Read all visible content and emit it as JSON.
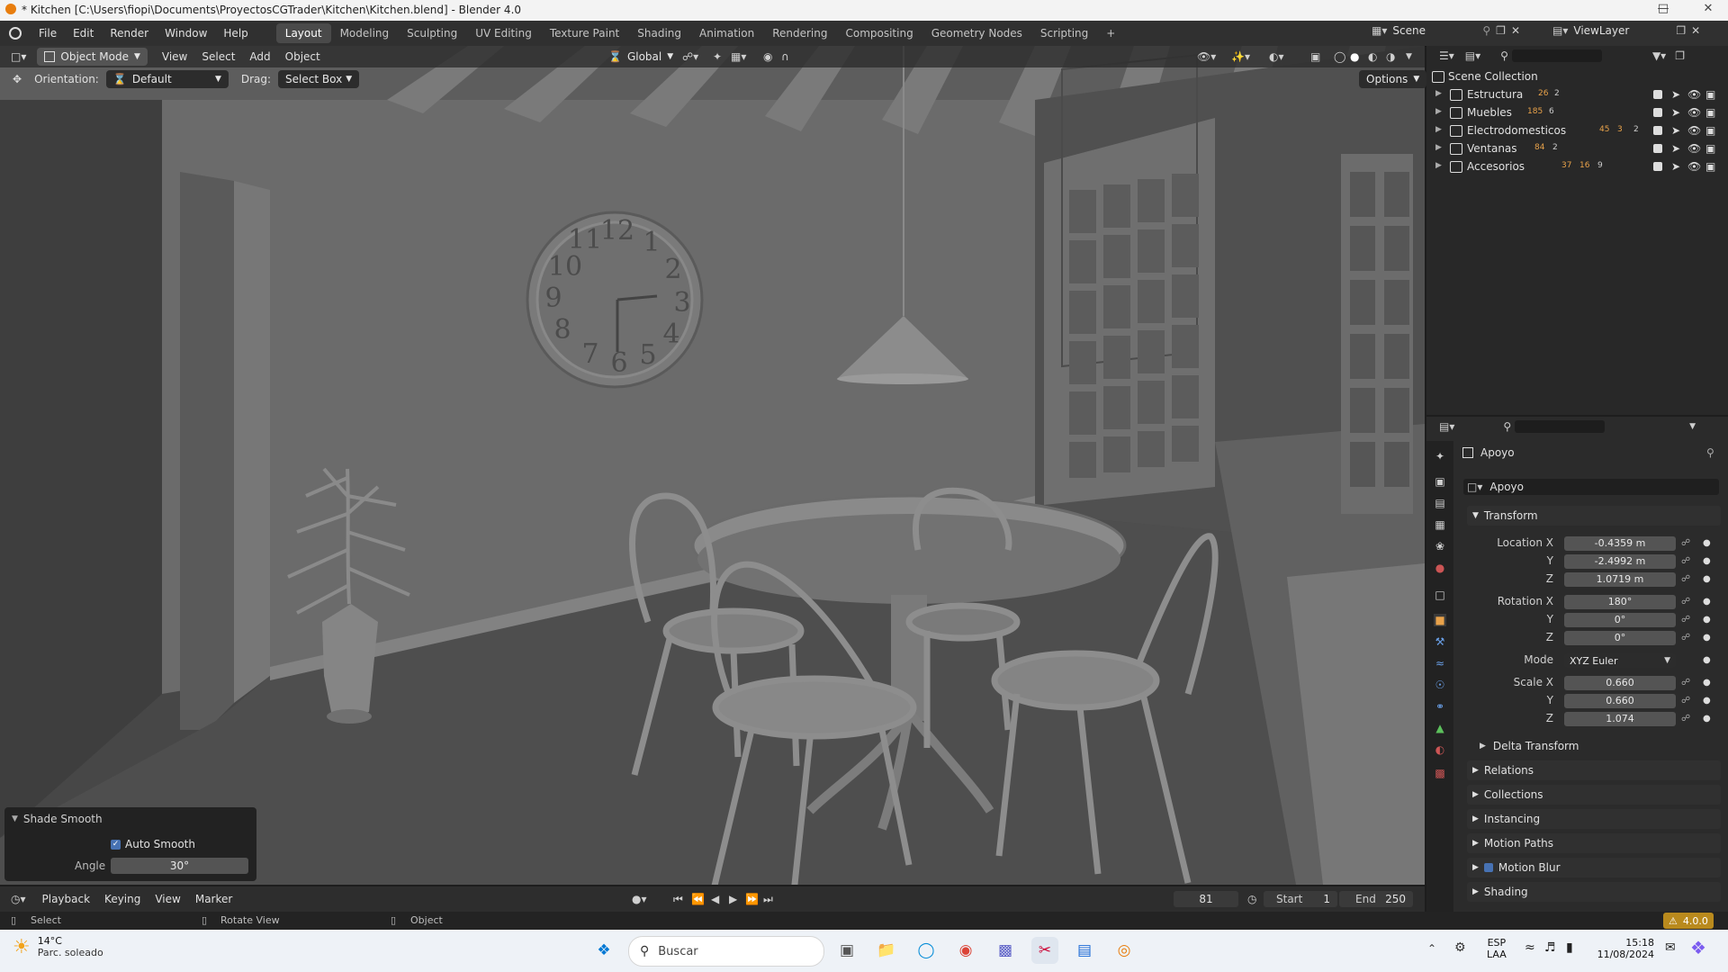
{
  "window": {
    "title": "* Kitchen [C:\\Users\\fiopi\\Documents\\ProyectosCGTrader\\Kitchen\\Kitchen.blend] - Blender 4.0"
  },
  "menus": [
    "File",
    "Edit",
    "Render",
    "Window",
    "Help"
  ],
  "workspaces": [
    "Layout",
    "Modeling",
    "Sculpting",
    "UV Editing",
    "Texture Paint",
    "Shading",
    "Animation",
    "Rendering",
    "Compositing",
    "Geometry Nodes",
    "Scripting"
  ],
  "scene": {
    "scene_name": "Scene",
    "view_layer": "ViewLayer"
  },
  "viewport_header": {
    "mode": "Object Mode",
    "menus": [
      "View",
      "Select",
      "Add",
      "Object"
    ],
    "transform_orientation": "Global",
    "options": "Options"
  },
  "tool_settings": {
    "orientation_label": "Orientation:",
    "orientation_value": "Default",
    "drag_label": "Drag:",
    "drag_value": "Select Box"
  },
  "clock_numbers": [
    "12",
    "1",
    "2",
    "3",
    "4",
    "5",
    "6",
    "7",
    "8",
    "9",
    "10",
    "11"
  ],
  "operator_panel": {
    "title": "Shade Smooth",
    "auto_smooth_label": "Auto Smooth",
    "auto_smooth_checked": true,
    "angle_label": "Angle",
    "angle_value": "30°"
  },
  "outliner": {
    "root": "Scene Collection",
    "items": [
      {
        "name": "Estructura",
        "counts": [
          "26",
          "2"
        ]
      },
      {
        "name": "Muebles",
        "counts": [
          "185",
          "6"
        ]
      },
      {
        "name": "Electrodomesticos",
        "counts": [
          "45",
          "3",
          "2"
        ]
      },
      {
        "name": "Ventanas",
        "counts": [
          "84",
          "2"
        ]
      },
      {
        "name": "Accesorios",
        "counts": [
          "37",
          "16",
          "9"
        ]
      }
    ]
  },
  "properties": {
    "object_name": "Apoyo",
    "data_name": "Apoyo",
    "transform_title": "Transform",
    "location_label": "Location X",
    "location": {
      "x": "-0.4359 m",
      "y": "-2.4992 m",
      "z": "1.0719 m"
    },
    "rotation_label": "Rotation X",
    "rotation": {
      "x": "180°",
      "y": "0°",
      "z": "0°"
    },
    "mode_label": "Mode",
    "mode_value": "XYZ Euler",
    "scale_label": "Scale X",
    "scale": {
      "x": "0.660",
      "y": "0.660",
      "z": "1.074"
    },
    "y_label": "Y",
    "z_label": "Z",
    "delta_transform": "Delta Transform",
    "sections": [
      "Relations",
      "Collections",
      "Instancing",
      "Motion Paths",
      "Motion Blur",
      "Shading"
    ]
  },
  "timeline": {
    "menus": [
      "Playback",
      "Keying",
      "View",
      "Marker"
    ],
    "current_frame": "81",
    "start_label": "Start",
    "start": "1",
    "end_label": "End",
    "end": "250"
  },
  "statusbar": {
    "left": "Select",
    "middle": "Rotate View",
    "right": "Object",
    "version": "4.0.0"
  },
  "taskbar": {
    "weather_temp": "14°C",
    "weather_desc": "Parc. soleado",
    "search_placeholder": "Buscar",
    "lang1": "ESP",
    "lang2": "LAA",
    "time": "15:18",
    "date": "11/08/2024"
  },
  "colors": {
    "accent_blue": "#4772b3",
    "active_object_orange": "#e8a24a",
    "viewport_bg": "#3d3d3d"
  }
}
